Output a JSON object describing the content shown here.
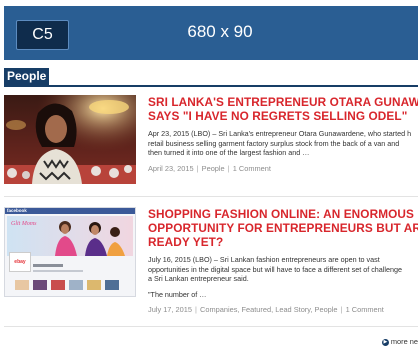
{
  "banner": {
    "tag": "C5",
    "size_text": "680 x 90"
  },
  "section": {
    "title": "People"
  },
  "articles": [
    {
      "headline_lines": [
        "SRI LANKA'S ENTREPRENEUR OTARA GUNAWARDENE",
        "SAYS \"I HAVE NO REGRETS SELLING ODEL\""
      ],
      "excerpt_lines": [
        "Apr 23, 2015 (LBO) – Sri Lanka's entrepreneur Otara Gunawardene, who started h",
        "retail business selling garment factory surplus stock from the back of a van and",
        "then turned it into one of the largest fashion and …"
      ],
      "date": "April 23, 2015",
      "categories": [
        "People"
      ],
      "comments": "1 Comment"
    },
    {
      "headline_lines": [
        "SHOPPING FASHION ONLINE: AN ENORMOUS",
        "OPPORTUNITY FOR ENTREPRENEURS BUT ARE WE",
        "READY YET?"
      ],
      "excerpt_lines": [
        "July 16, 2015 (LBO) – Sri Lankan fashion entrepreneurs are open to vast",
        "opportunities in the digital space but will have to face a different set of challenge",
        "a Sri Lankan entrepreneur said."
      ],
      "quote": "\"The number of …",
      "date": "July 17, 2015",
      "categories": [
        "Companies",
        "Featured",
        "Lead Story",
        "People"
      ],
      "comments": "1 Comment"
    }
  ],
  "thumb2": {
    "brand": "facebook",
    "ebay": "ebay"
  },
  "more_news": "more ne",
  "colors": {
    "accent": "#d8262c",
    "navy": "#173d66",
    "banner": "#2a5e93"
  }
}
